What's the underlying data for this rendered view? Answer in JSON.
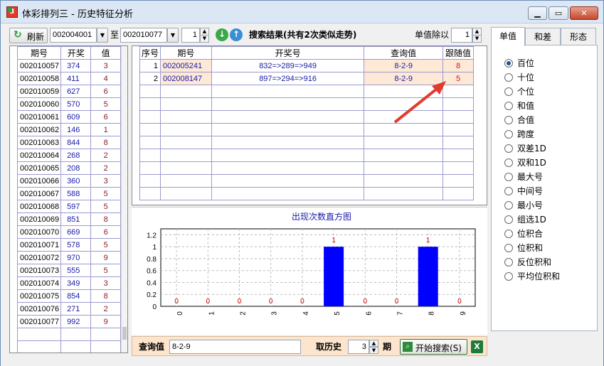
{
  "window": {
    "title": "体彩排列三 - 历史特征分析",
    "app_icon_text": "3"
  },
  "toolbar": {
    "refresh_label": "刷新",
    "from_period": "002004001",
    "to_label": "至",
    "to_period": "002010077",
    "step_value": "1",
    "result_title": "搜索结果(共有2次类似走势)",
    "divide_label": "单值除以",
    "divide_value": "1"
  },
  "left_table": {
    "headers": [
      "期号",
      "开奖",
      "值"
    ],
    "rows": [
      [
        "002010057",
        "374",
        "3"
      ],
      [
        "002010058",
        "411",
        "4"
      ],
      [
        "002010059",
        "627",
        "6"
      ],
      [
        "002010060",
        "570",
        "5"
      ],
      [
        "002010061",
        "609",
        "6"
      ],
      [
        "002010062",
        "146",
        "1"
      ],
      [
        "002010063",
        "844",
        "8"
      ],
      [
        "002010064",
        "268",
        "2"
      ],
      [
        "002010065",
        "208",
        "2"
      ],
      [
        "002010066",
        "360",
        "3"
      ],
      [
        "002010067",
        "588",
        "5"
      ],
      [
        "002010068",
        "597",
        "5"
      ],
      [
        "002010069",
        "851",
        "8"
      ],
      [
        "002010070",
        "669",
        "6"
      ],
      [
        "002010071",
        "578",
        "5"
      ],
      [
        "002010072",
        "970",
        "9"
      ],
      [
        "002010073",
        "555",
        "5"
      ],
      [
        "002010074",
        "349",
        "3"
      ],
      [
        "002010075",
        "854",
        "8"
      ],
      [
        "002010076",
        "271",
        "2"
      ],
      [
        "002010077",
        "992",
        "9"
      ]
    ]
  },
  "result_table": {
    "headers": [
      "序号",
      "期号",
      "开奖号",
      "查询值",
      "跟随值"
    ],
    "rows": [
      [
        "1",
        "002005241",
        "832=>289=>949",
        "8-2-9",
        "8"
      ],
      [
        "2",
        "002008147",
        "897=>294=>916",
        "8-2-9",
        "5"
      ]
    ]
  },
  "chart_data": {
    "type": "bar",
    "title": "出现次数直方图",
    "categories": [
      "0",
      "1",
      "2",
      "3",
      "4",
      "5",
      "6",
      "7",
      "8",
      "9"
    ],
    "values": [
      0,
      0,
      0,
      0,
      0,
      1,
      0,
      0,
      1,
      0
    ],
    "ylim": [
      0,
      1.3
    ],
    "yticks": [
      "0",
      "0.2",
      "0.4",
      "0.6",
      "0.8",
      "1",
      "1.2"
    ],
    "grid": true,
    "bar_color": "#0000ff",
    "label_color": "#cc0000"
  },
  "bottom": {
    "query_label": "查询值",
    "query_value": "8-2-9",
    "history_label": "取历史",
    "history_value": "3",
    "period_label": "期",
    "search_button": "开始搜索(S)"
  },
  "right_panel": {
    "tabs": [
      "单值",
      "和差",
      "形态"
    ],
    "active_tab": "单值",
    "options": [
      "百位",
      "十位",
      "个位",
      "和值",
      "合值",
      "跨度",
      "双差1D",
      "双和1D",
      "最大号",
      "中间号",
      "最小号",
      "组选1D",
      "位积合",
      "位积和",
      "反位积和",
      "平均位积和"
    ],
    "selected": "百位"
  },
  "colors": {
    "accent_peach": "#fde4cc",
    "arrow": "#e23b2e"
  }
}
